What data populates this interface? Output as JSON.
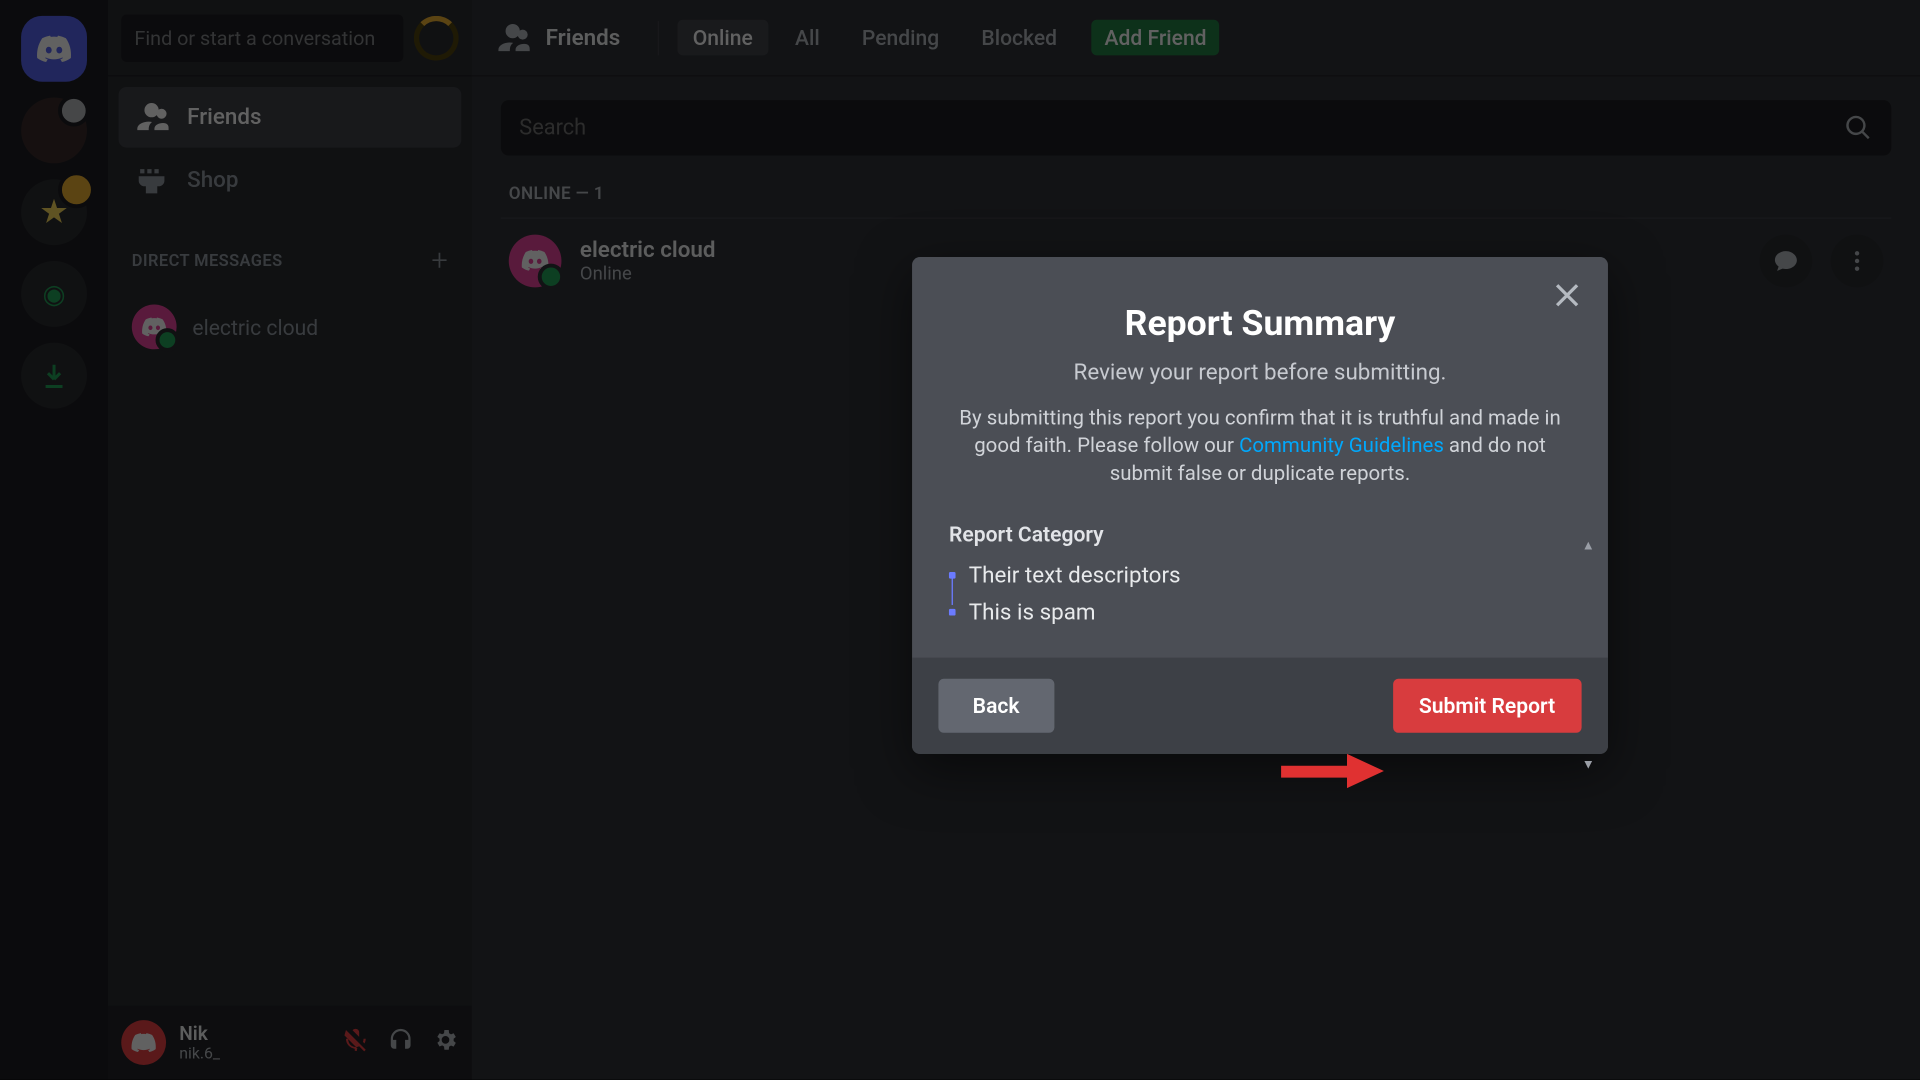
{
  "searchbar_placeholder": "Find or start a conversation",
  "nav": {
    "friends": "Friends",
    "shop": "Shop"
  },
  "dm_header": "DIRECT MESSAGES",
  "dm_items": {
    "0": {
      "name": "electric cloud"
    }
  },
  "user": {
    "name": "Nik",
    "tag": "nik.6_"
  },
  "topbar": {
    "friends": "Friends",
    "tabs": {
      "online": "Online",
      "all": "All",
      "pending": "Pending",
      "blocked": "Blocked",
      "add": "Add Friend"
    }
  },
  "search_placeholder": "Search",
  "list_header": "ONLINE — 1",
  "friend": {
    "name": "electric cloud",
    "status": "Online"
  },
  "modal": {
    "title": "Report Summary",
    "sub": "Review your report before submitting.",
    "para_pre": "By submitting this report you confirm that it is truthful and made in good faith. Please follow our ",
    "link": "Community Guidelines",
    "para_post": " and do not submit false or duplicate reports.",
    "section": "Report Category",
    "items": {
      "0": "Their text descriptors",
      "1": "This is spam"
    },
    "back": "Back",
    "submit": "Submit Report"
  }
}
